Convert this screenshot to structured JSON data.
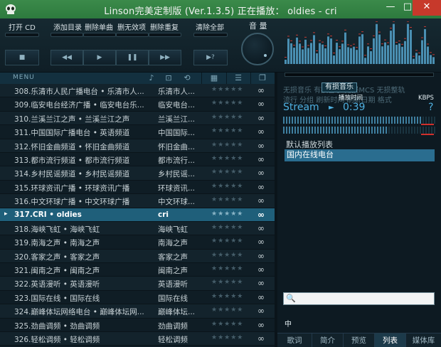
{
  "window": {
    "title": "Linson完美定制版 (Ver.1.3.5)   正在播放： oldies - cri",
    "min_label": "—",
    "max_label": "□",
    "close_label": "✕"
  },
  "toolbar": {
    "open_cd": "打开 CD",
    "add_dir": "添加目录",
    "del_single": "删除单曲",
    "del_invalid": "删无效项",
    "del_dup": "删除重复",
    "clear_all": "清除全部",
    "volume": "音 量",
    "stop": "■",
    "prev": "◀◀",
    "play": "▶",
    "pause": "❚❚",
    "next": "▶▶",
    "eject": "▶?"
  },
  "list_header": {
    "menu": "MENU"
  },
  "playlist": [
    {
      "title": "308.乐清市人民广播电台 • 乐清市人...",
      "artist": "乐清市人...",
      "rating": "★★★★★",
      "duration": "∞"
    },
    {
      "title": "309.临安电台经济广播 • 临安电台乐...",
      "artist": "临安电台...",
      "rating": "★★★★★",
      "duration": "∞"
    },
    {
      "title": "310.兰溪兰江之声 • 兰溪兰江之声",
      "artist": "兰溪兰江...",
      "rating": "★★★★★",
      "duration": "∞"
    },
    {
      "title": "311.中国国际广播电台 • 英语频道",
      "artist": "中国国际...",
      "rating": "★★★★★",
      "duration": "∞"
    },
    {
      "title": "312.怀旧金曲频道 • 怀旧金曲频道",
      "artist": "怀旧金曲...",
      "rating": "★★★★★",
      "duration": "∞"
    },
    {
      "title": "313.都市流行频道 • 都市流行频道",
      "artist": "都市流行...",
      "rating": "★★★★★",
      "duration": "∞"
    },
    {
      "title": "314.乡村民谣频道 • 乡村民谣频道",
      "artist": "乡村民谣...",
      "rating": "★★★★★",
      "duration": "∞"
    },
    {
      "title": "315.环球资讯广播 • 环球资讯广播",
      "artist": "环球资讯...",
      "rating": "★★★★★",
      "duration": "∞"
    },
    {
      "title": "316.中文环球广播 • 中文环球广播",
      "artist": "中文环球...",
      "rating": "★★★★★",
      "duration": "∞"
    },
    {
      "title": "317.CRI • oldies",
      "artist": "cri",
      "rating": "★★★★★",
      "duration": "∞",
      "active": true
    },
    {
      "title": "318.海峡飞虹 • 海峡飞虹",
      "artist": "海峡飞虹",
      "rating": "★★★★★",
      "duration": "∞"
    },
    {
      "title": "319.南海之声 • 南海之声",
      "artist": "南海之声",
      "rating": "★★★★★",
      "duration": "∞"
    },
    {
      "title": "320.客家之声 • 客家之声",
      "artist": "客家之声",
      "rating": "★★★★★",
      "duration": "∞"
    },
    {
      "title": "321.闽南之声 • 闽南之声",
      "artist": "闽南之声",
      "rating": "★★★★★",
      "duration": "∞"
    },
    {
      "title": "322.英语漫听 • 英语漫听",
      "artist": "英语漫听",
      "rating": "★★★★★",
      "duration": "∞"
    },
    {
      "title": "323.国际在线 • 国际在线",
      "artist": "国际在线",
      "rating": "★★★★★",
      "duration": "∞"
    },
    {
      "title": "324.巅峰体坛网络电台 • 巅峰体坛网...",
      "artist": "巅峰体坛...",
      "rating": "★★★★★",
      "duration": "∞"
    },
    {
      "title": "325.劲曲调频 • 劲曲调频",
      "artist": "劲曲调频",
      "rating": "★★★★★",
      "duration": "∞"
    },
    {
      "title": "326.轻松调频 • 轻松调频",
      "artist": "轻松调频",
      "rating": "★★★★★",
      "duration": "∞"
    }
  ],
  "right": {
    "categories_top": "无损音乐      有损音乐      无损MCS  无损整轨",
    "active_category": "有损音乐",
    "categories_bottom": "流行    分组      刷新时间    刷新日期   格式",
    "info_time_label": "播放时间",
    "info_kbps_label": "KBPS",
    "stream_label": "Stream",
    "stream_arrow": "►",
    "elapsed": "0:39",
    "qmark": "?",
    "playlist_name": "默认播放列表",
    "playlist_item": "国内在线电台",
    "ime": "中"
  },
  "tabs": [
    {
      "label": "歌词"
    },
    {
      "label": "简介"
    },
    {
      "label": "预览"
    },
    {
      "label": "列表",
      "active": true
    },
    {
      "label": "媒体库"
    }
  ]
}
